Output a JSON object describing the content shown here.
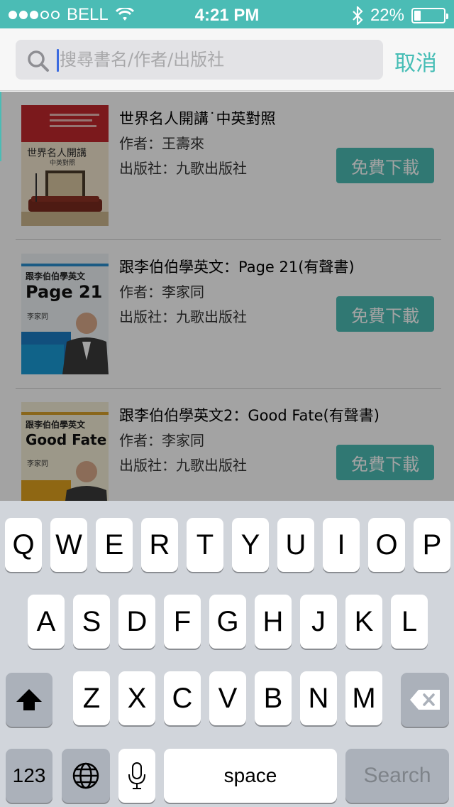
{
  "status_bar": {
    "carrier": "BELL",
    "time": "4:21 PM",
    "battery_percent": "22%",
    "battery_level": 0.22,
    "signal_bars_filled": 3,
    "signal_bars_total": 5
  },
  "search": {
    "placeholder": "搜尋書名/作者/出版社",
    "value": "",
    "cancel_label": "取消"
  },
  "books": [
    {
      "title": "世界名人開講˙中英對照",
      "author": "作者：王壽來",
      "publisher": "出版社：九歌出版社",
      "download_label": "免費下載",
      "cover_title": "世界名人開講",
      "cover_subtitle": "中英對照"
    },
    {
      "title": "跟李伯伯學英文：Page 21(有聲書)",
      "author": "作者：李家同",
      "publisher": "出版社：九歌出版社",
      "download_label": "免費下載",
      "cover_title": "跟李伯伯學英文",
      "cover_subtitle": "Page 21"
    },
    {
      "title": "跟李伯伯學英文2：Good Fate(有聲書)",
      "author": "作者：李家同",
      "publisher": "出版社：九歌出版社",
      "download_label": "免費下載",
      "cover_title": "跟李伯伯學英文",
      "cover_subtitle": "Good Fate"
    }
  ],
  "keyboard": {
    "row1": [
      "Q",
      "W",
      "E",
      "R",
      "T",
      "Y",
      "U",
      "I",
      "O",
      "P"
    ],
    "row2": [
      "A",
      "S",
      "D",
      "F",
      "G",
      "H",
      "J",
      "K",
      "L"
    ],
    "row3": [
      "Z",
      "X",
      "C",
      "V",
      "B",
      "N",
      "M"
    ],
    "numbers_label": "123",
    "space_label": "space",
    "search_label": "Search"
  },
  "colors": {
    "accent": "#4bbcb5",
    "keyboard_bg": "#d1d5db"
  }
}
